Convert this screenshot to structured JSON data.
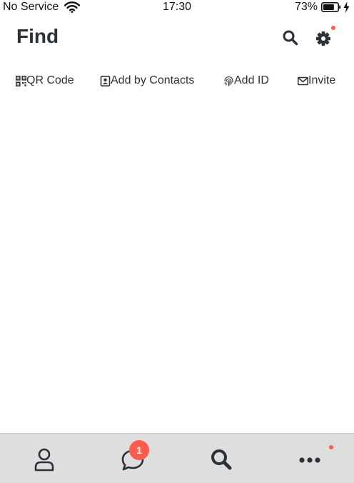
{
  "status_bar": {
    "carrier": "No Service",
    "time": "17:30",
    "battery": "73%",
    "battery_level": 0.73
  },
  "header": {
    "title": "Find",
    "search_icon": "search-icon",
    "settings_icon": "gear-icon",
    "settings_has_dot": true
  },
  "actions": [
    {
      "label": "QR Code",
      "icon": "qr-code-icon"
    },
    {
      "label": "Add by Contacts",
      "icon": "contact-card-icon"
    },
    {
      "label": "Add ID",
      "icon": "fingerprint-icon"
    },
    {
      "label": "Invite",
      "icon": "envelope-icon"
    }
  ],
  "tabbar": {
    "tabs": [
      {
        "icon": "person-icon"
      },
      {
        "icon": "chat-bubble-icon",
        "badge": "1"
      },
      {
        "icon": "search-icon"
      },
      {
        "icon": "more-dots-icon",
        "has_dot": true
      }
    ]
  },
  "colors": {
    "accent_red": "#ff5a4e",
    "text_dark": "#2c3138",
    "tabbar_bg": "#dedede"
  }
}
